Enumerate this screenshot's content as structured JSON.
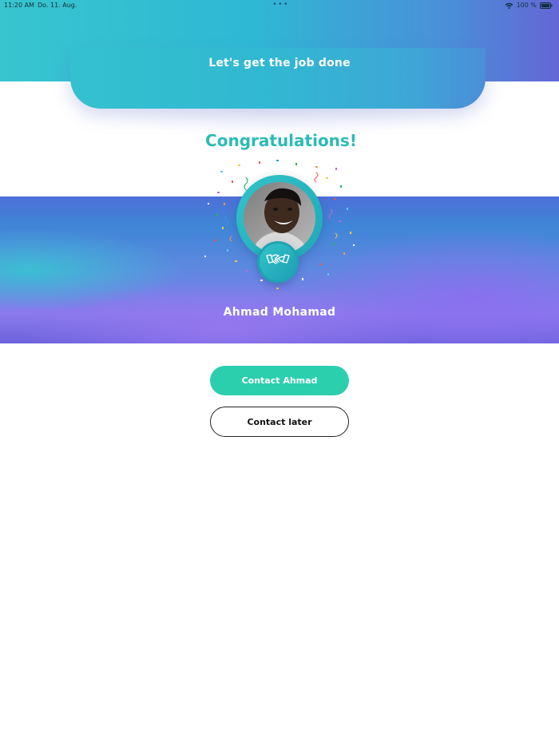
{
  "status_bar": {
    "time": "11:20 AM",
    "date": "Do. 11. Aug.",
    "dots": "•••",
    "battery_text": "100 %",
    "icons": [
      "wifi-icon",
      "battery-icon"
    ]
  },
  "header": {
    "title": "Let's get the job done"
  },
  "result": {
    "heading": "Congratulations!",
    "avatar": "person-photo",
    "badge_icon": "handshake-icon",
    "decoration": "confetti",
    "name": "Ahmad Mohamad"
  },
  "actions": {
    "primary_label": "Contact Ahmad",
    "secondary_label": "Contact later"
  },
  "colors": {
    "accent_teal": "#2bbbb5",
    "primary_button": "#2bcfae",
    "header_gradient_start": "#38c5cf",
    "header_gradient_end": "#6566d6",
    "band_purple": "#8a79ec"
  }
}
